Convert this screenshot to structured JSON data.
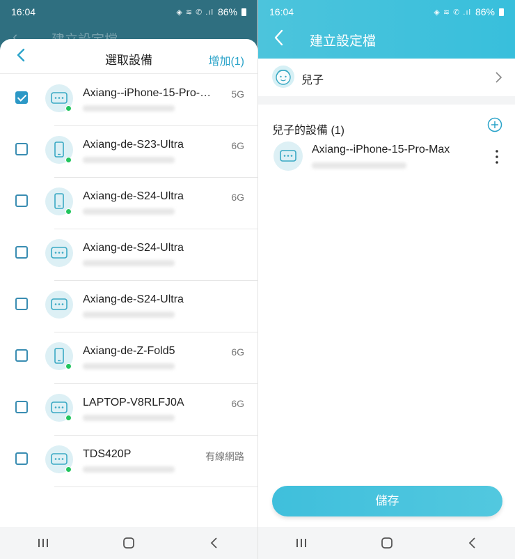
{
  "status": {
    "time": "16:04",
    "battery": "86%",
    "icons": "◈ ≋ ✆ .ıl"
  },
  "left": {
    "bg_title": "建立設定檔",
    "sheet": {
      "back_icon": "chevron-left-icon",
      "title": "選取設備",
      "add_label": "增加(1)"
    },
    "devices": [
      {
        "name": "Axiang--iPhone-15-Pro-Max",
        "band": "5G",
        "checked": true,
        "icon": "device-generic-icon"
      },
      {
        "name": "Axiang-de-S23-Ultra",
        "band": "6G",
        "checked": false,
        "icon": "phone-icon"
      },
      {
        "name": "Axiang-de-S24-Ultra",
        "band": "6G",
        "checked": false,
        "icon": "phone-icon"
      },
      {
        "name": "Axiang-de-S24-Ultra",
        "band": "",
        "checked": false,
        "icon": "device-generic-icon"
      },
      {
        "name": "Axiang-de-S24-Ultra",
        "band": "",
        "checked": false,
        "icon": "device-generic-icon"
      },
      {
        "name": "Axiang-de-Z-Fold5",
        "band": "6G",
        "checked": false,
        "icon": "phone-icon"
      },
      {
        "name": "LAPTOP-V8RLFJ0A",
        "band": "6G",
        "checked": false,
        "icon": "device-generic-icon"
      },
      {
        "name": "TDS420P",
        "band": "有線網路",
        "checked": false,
        "icon": "device-generic-icon"
      }
    ]
  },
  "right": {
    "title": "建立設定檔",
    "profile_name": "兒子",
    "section_title": "兒子的設備 (1)",
    "device": {
      "name": "Axiang--iPhone-15-Pro-Max"
    },
    "save_label": "儲存"
  },
  "colors": {
    "accent": "#2aa3c9",
    "header": "#45c2dc",
    "online": "#22c55e",
    "checkbox": "#2c98c6"
  }
}
